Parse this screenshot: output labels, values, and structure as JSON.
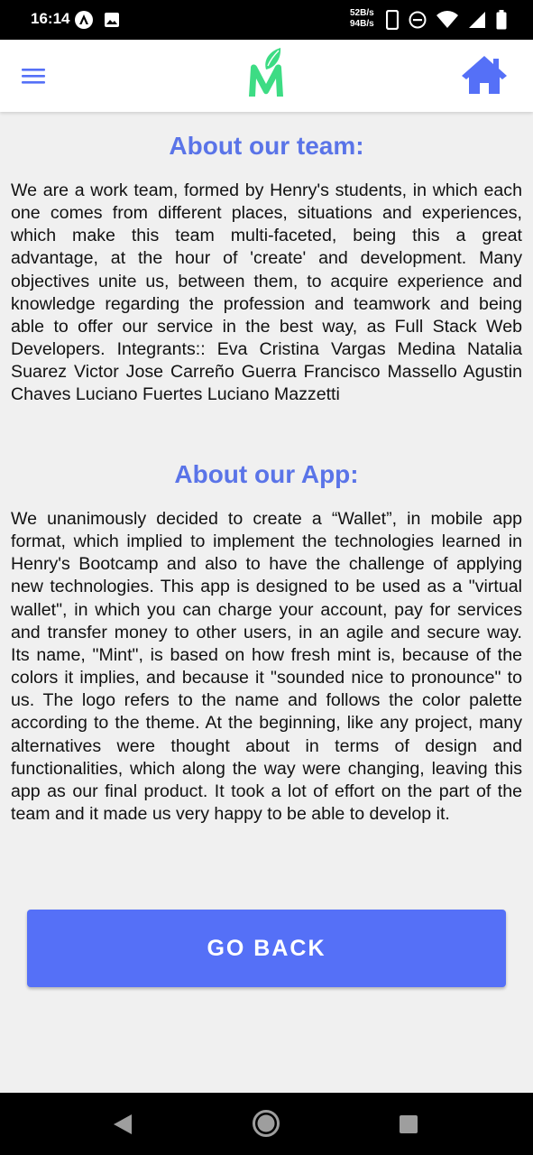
{
  "status_bar": {
    "time": "16:14",
    "net_up": "52B/s",
    "net_down": "94B/s",
    "left_icons": [
      "app-notification-icon",
      "image-notification-icon"
    ],
    "right_icons": [
      "phone-icon",
      "do-not-disturb-icon",
      "wifi-icon",
      "signal-icon",
      "battery-icon"
    ]
  },
  "app_bar": {
    "menu_icon": "hamburger-menu-icon",
    "logo_icon": "mint-logo-icon",
    "home_icon": "home-icon"
  },
  "colors": {
    "accent": "#5a74e8",
    "button": "#5570f7",
    "logo_green": "#3ddc84",
    "background": "#f0f0f0"
  },
  "team": {
    "title": "About our team:",
    "text": "We are a work team, formed by Henry's students, in which each one comes from different places, situations and experiences, which make this team multi-faceted, being this a great advantage, at the  hour of 'create' and development. Many objectives unite us, between them, to acquire experience and knowledge regarding the profession and teamwork and being able to offer our service in the best way, as Full Stack Web Developers. Integrants:: Eva Cristina Vargas Medina Natalia Suarez Victor Jose Carreño Guerra Francisco Massello Agustin Chaves Luciano Fuertes Luciano Mazzetti"
  },
  "app": {
    "title": "About our App:",
    "text": "We unanimously decided to create a “Wallet”, in mobile app format, which implied to implement the technologies learned in Henry's Bootcamp and also to have the challenge of applying new technologies. This app is designed to be used as a \"virtual wallet\", in which you can charge your account, pay for services and transfer money to other users, in an agile and secure way. Its name, \"Mint\", is based on how fresh mint is, because of the colors it implies, and because it \"sounded nice to pronounce\" to us. The logo refers to the name and follows the color palette according to the theme. At the beginning, like any project, many alternatives were thought about in terms of design and functionalities, which along the way were changing, leaving this app as our final product. It took a lot of effort on the part of the team and it made us very happy to be able to develop it."
  },
  "go_back_label": "GO BACK",
  "nav_bar": {
    "icons": [
      "back-triangle-icon",
      "home-circle-icon",
      "recent-apps-square-icon"
    ]
  }
}
